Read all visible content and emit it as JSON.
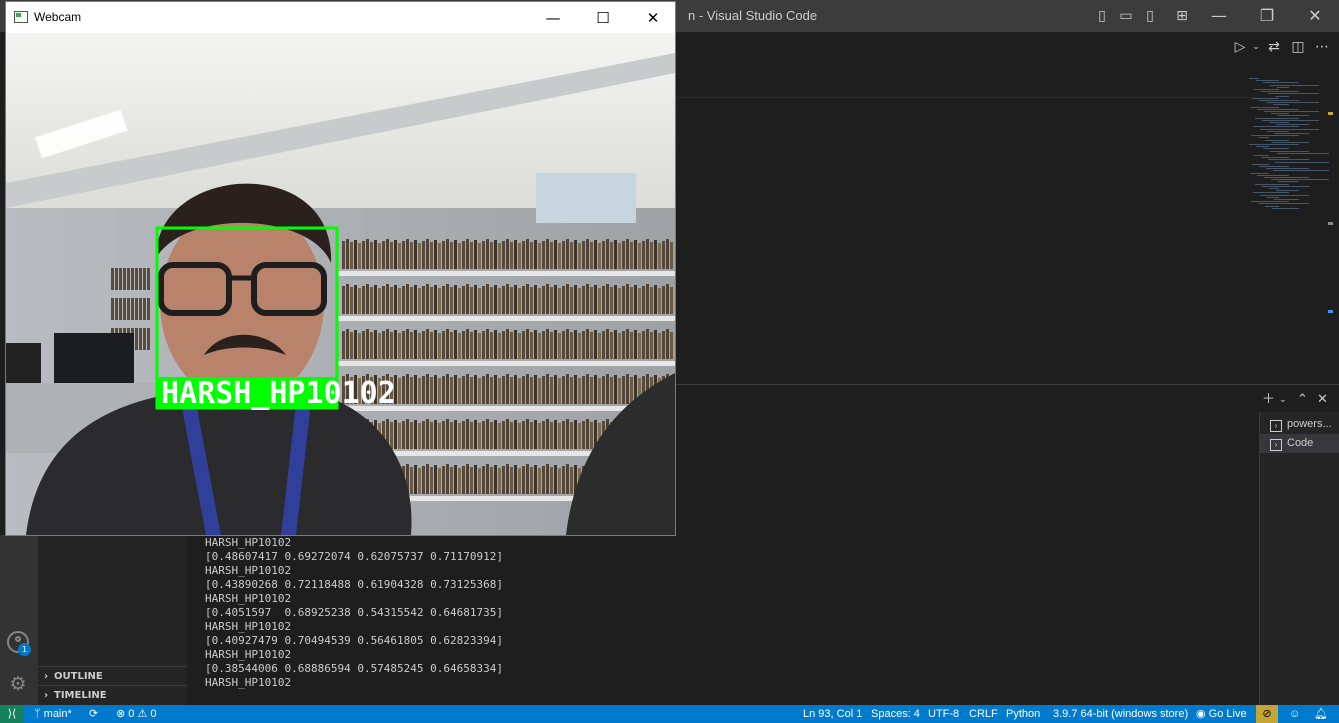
{
  "vscode": {
    "title_fragment": "n - Visual Studio Code"
  },
  "webcam_window": {
    "title": "Webcam",
    "label_text": "HARSH_HP10102"
  },
  "sidebar": {
    "sections": [
      "OUTLINE",
      "TIMELINE"
    ],
    "accounts_badge": "1"
  },
  "terminal": {
    "tabs": [
      {
        "label": "powers...",
        "active": false
      },
      {
        "label": "Code",
        "active": true
      }
    ],
    "output_lines": [
      "HARSH_HP10102",
      "[0.48607417 0.69272074 0.62075737 0.71170912]",
      "HARSH_HP10102",
      "[0.43890268 0.72118488 0.61904328 0.73125368]",
      "HARSH_HP10102",
      "[0.4051597  0.68925238 0.54315542 0.64681735]",
      "HARSH_HP10102",
      "[0.40927479 0.70494539 0.56461805 0.62823394]",
      "HARSH_HP10102",
      "[0.38544006 0.68886594 0.57485245 0.64658334]",
      "HARSH_HP10102"
    ]
  },
  "statusbar": {
    "branch": "main*",
    "errors": "0",
    "warnings": "0",
    "position": "Ln 93, Col 1",
    "spaces": "Spaces: 4",
    "encoding": "UTF-8",
    "eol": "CRLF",
    "language": "Python",
    "interpreter": "3.9.7 64-bit (windows store)",
    "live": "Go Live"
  },
  "colors": {
    "statusbar": "#007acc",
    "remote": "#16825d",
    "bbox": "#00ff00"
  }
}
